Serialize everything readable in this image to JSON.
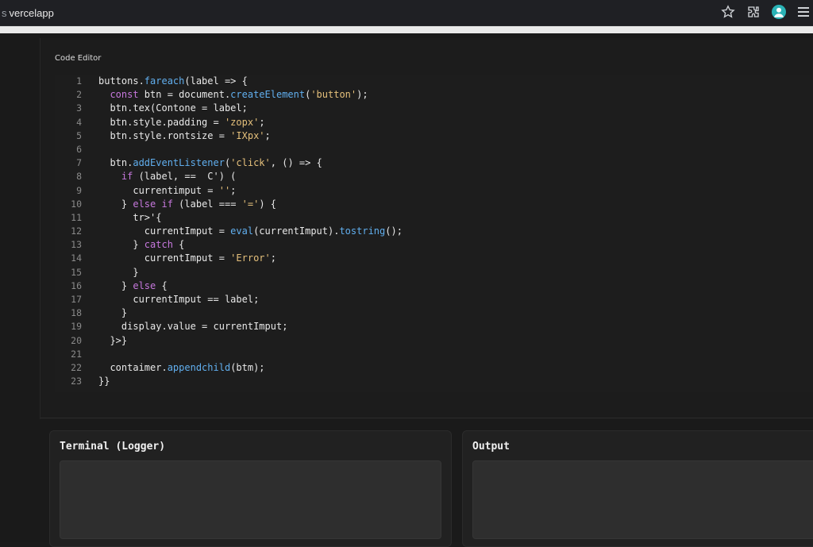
{
  "browser": {
    "url_prefix": "s",
    "url": "vercelapp",
    "icons": [
      "star-icon",
      "extensions-icon",
      "profile-icon",
      "menu-icon"
    ]
  },
  "editor": {
    "title": "Code Editor",
    "lines": [
      {
        "n": "1",
        "text": "buttons.fareach(label => {"
      },
      {
        "n": "2",
        "text": "  const btn = document.createElement('button');"
      },
      {
        "n": "3",
        "text": "  btn.tex(Contone = label;"
      },
      {
        "n": "4",
        "text": "  btn.style.padding = 'zopx';"
      },
      {
        "n": "5",
        "text": "  btn.style.rontsize = 'IXpx';"
      },
      {
        "n": "6",
        "text": ""
      },
      {
        "n": "7",
        "text": "  btn.addEventListener('click', () => {"
      },
      {
        "n": "8",
        "text": "    if (label, ==  C') ("
      },
      {
        "n": "9",
        "text": "      currentimput = '';"
      },
      {
        "n": "10",
        "text": "    } else if (label === '=') {"
      },
      {
        "n": "11",
        "text": "      tr>'{"
      },
      {
        "n": "12",
        "text": "        currentImput = eval(currentImput).tostring();"
      },
      {
        "n": "13",
        "text": "      } catch {"
      },
      {
        "n": "14",
        "text": "        currentImput = 'Error';"
      },
      {
        "n": "15",
        "text": "      }"
      },
      {
        "n": "16",
        "text": "    } else {"
      },
      {
        "n": "17",
        "text": "      currentImput == label;"
      },
      {
        "n": "18",
        "text": "    }"
      },
      {
        "n": "19",
        "text": "    display.value = currentImput;"
      },
      {
        "n": "20",
        "text": "  }>}"
      },
      {
        "n": "21",
        "text": ""
      },
      {
        "n": "22",
        "text": "  contaimer.appendchild(btm);"
      },
      {
        "n": "23",
        "text": "}}"
      }
    ]
  },
  "terminal": {
    "title": "Terminal (Logger)"
  },
  "output": {
    "title": "Output"
  },
  "colors": {
    "background": "#1a1a1a",
    "keyword": "#c678dd",
    "function": "#61afef",
    "string": "#e5c07b",
    "profile_accent": "#2bb3b6"
  }
}
